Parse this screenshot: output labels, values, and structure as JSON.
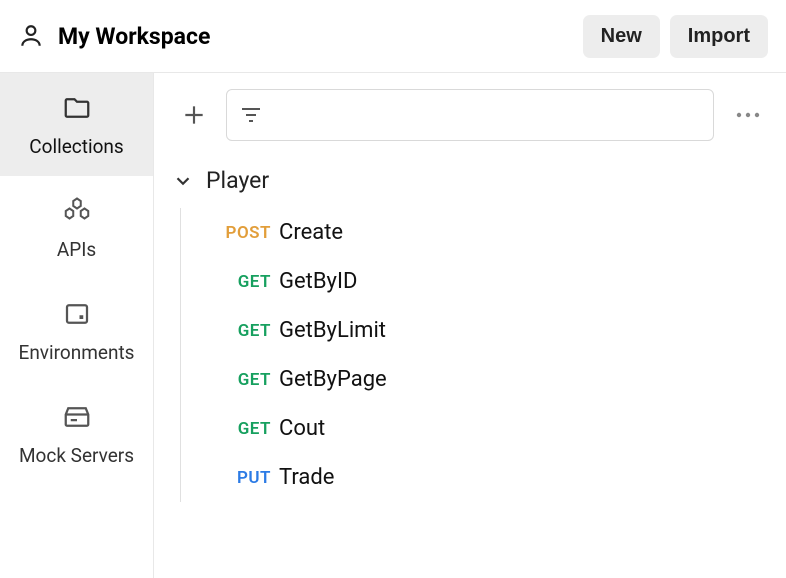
{
  "header": {
    "workspace_title": "My Workspace",
    "new_label": "New",
    "import_label": "Import"
  },
  "sidebar": {
    "items": [
      {
        "label": "Collections"
      },
      {
        "label": "APIs"
      },
      {
        "label": "Environments"
      },
      {
        "label": "Mock Servers"
      }
    ]
  },
  "collection": {
    "folder_name": "Player",
    "requests": [
      {
        "method": "POST",
        "name": "Create"
      },
      {
        "method": "GET",
        "name": "GetByID"
      },
      {
        "method": "GET",
        "name": "GetByLimit"
      },
      {
        "method": "GET",
        "name": "GetByPage"
      },
      {
        "method": "GET",
        "name": "Cout"
      },
      {
        "method": "PUT",
        "name": "Trade"
      }
    ]
  }
}
